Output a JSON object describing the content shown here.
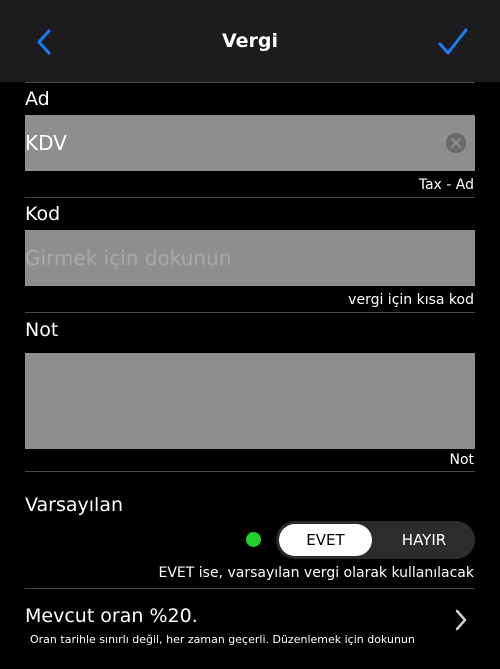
{
  "nav": {
    "title": "Vergi",
    "back_icon": "chevron-left-icon",
    "done_icon": "checkmark-icon"
  },
  "name_field": {
    "label": "Ad",
    "value": "KDV",
    "hint": "Tax - Ad",
    "clear_icon": "clear-circle-icon"
  },
  "code_field": {
    "label": "Kod",
    "placeholder": "Girmek için dokunun",
    "hint": "vergi için kısa kod"
  },
  "note_field": {
    "label": "Not",
    "hint": "Not"
  },
  "default_section": {
    "label": "Varsayılan",
    "options": [
      "EVET",
      "HAYIR"
    ],
    "selected": "EVET",
    "hint": "EVET ise, varsayılan vergi olarak kullanılacak"
  },
  "rate_row": {
    "title": "Mevcut oran %20.",
    "subtitle": "Oran tarihle sınırlı değil, her zaman geçerli. Düzenlemek için dokunun"
  },
  "colors": {
    "accent": "#1a7cf5",
    "status_green": "#22d12a",
    "field_bg": "#8e8e8e",
    "navbar_bg": "#1c1c1e"
  }
}
